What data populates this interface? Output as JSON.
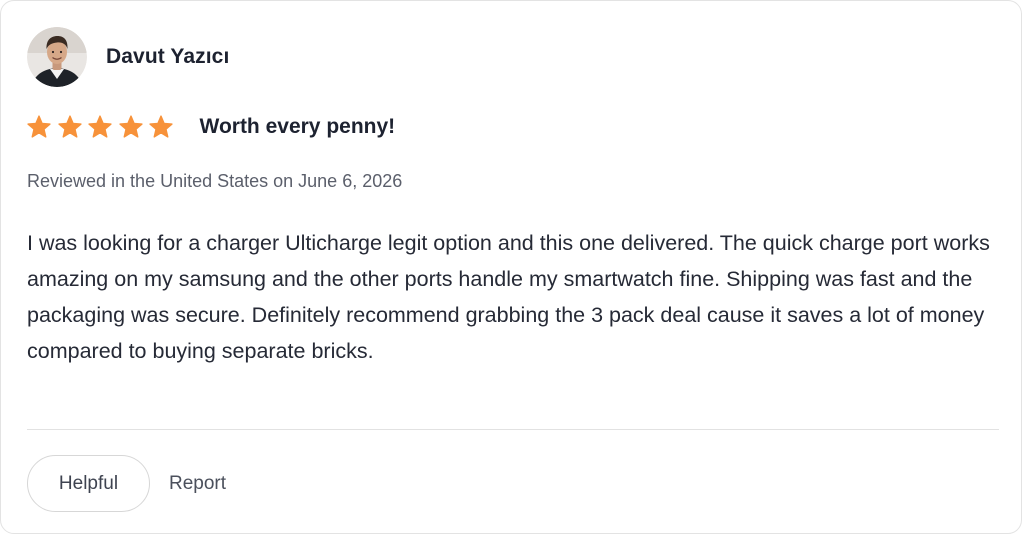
{
  "review": {
    "reviewer_name": "Davut Yazıcı",
    "avatar_icon": "user-avatar-photo",
    "rating": 5,
    "rating_max": 5,
    "star_color": "#F7923A",
    "title": "Worth every penny!",
    "meta": "Reviewed in the United States on June 6, 2026",
    "body": "I was looking for a charger Ulticharge legit option and this one delivered. The quick charge port works amazing on my samsung and the other ports handle my smartwatch fine. Shipping was fast and the packaging was secure. Definitely recommend grabbing the 3 pack deal cause it saves a lot of money compared to buying separate bricks."
  },
  "actions": {
    "helpful_label": "Helpful",
    "report_label": "Report"
  }
}
